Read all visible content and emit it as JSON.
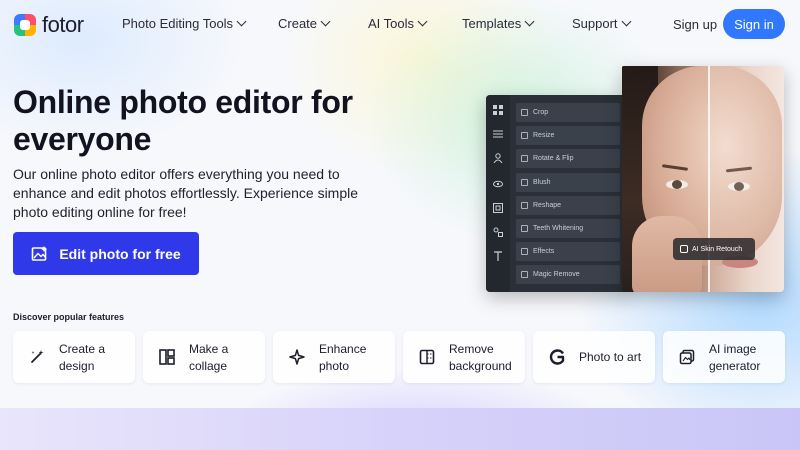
{
  "header": {
    "logo_text": "fotor",
    "nav": [
      {
        "label": "Photo Editing Tools"
      },
      {
        "label": "Create"
      },
      {
        "label": "AI Tools"
      },
      {
        "label": "Templates"
      },
      {
        "label": "Support"
      }
    ],
    "signup_label": "Sign up",
    "signin_label": "Sign in"
  },
  "hero": {
    "title": "Online photo editor for everyone",
    "description": "Our online photo editor offers everything you need to enhance and edit photos effortlessly. Experience simple photo editing online for free!",
    "cta_label": "Edit photo for free"
  },
  "editor": {
    "tools": [
      {
        "label": "Crop"
      },
      {
        "label": "Resize"
      },
      {
        "label": "Rotate & Flip"
      },
      {
        "label": "Blush"
      },
      {
        "label": "Reshape"
      },
      {
        "label": "Teeth Whitening"
      },
      {
        "label": "Effects"
      },
      {
        "label": "Magic Remove"
      }
    ],
    "badge_label": "AI Skin Retouch",
    "rail_icons": [
      "grid-icon",
      "sliders-icon",
      "person-icon",
      "eye-icon",
      "frame-icon",
      "elements-icon",
      "text-icon"
    ]
  },
  "features": {
    "heading": "Discover popular features",
    "items": [
      {
        "label": "Create a design",
        "icon": "magic-wand-icon"
      },
      {
        "label": "Make a collage",
        "icon": "collage-icon"
      },
      {
        "label": "Enhance photo",
        "icon": "sparkle-icon"
      },
      {
        "label": "Remove background",
        "icon": "remove-bg-icon"
      },
      {
        "label": "Photo to art",
        "icon": "art-g-icon"
      },
      {
        "label": "AI image generator",
        "icon": "ai-generator-icon"
      }
    ]
  },
  "colors": {
    "accent": "#2f78ff",
    "cta": "#2f39ea"
  }
}
